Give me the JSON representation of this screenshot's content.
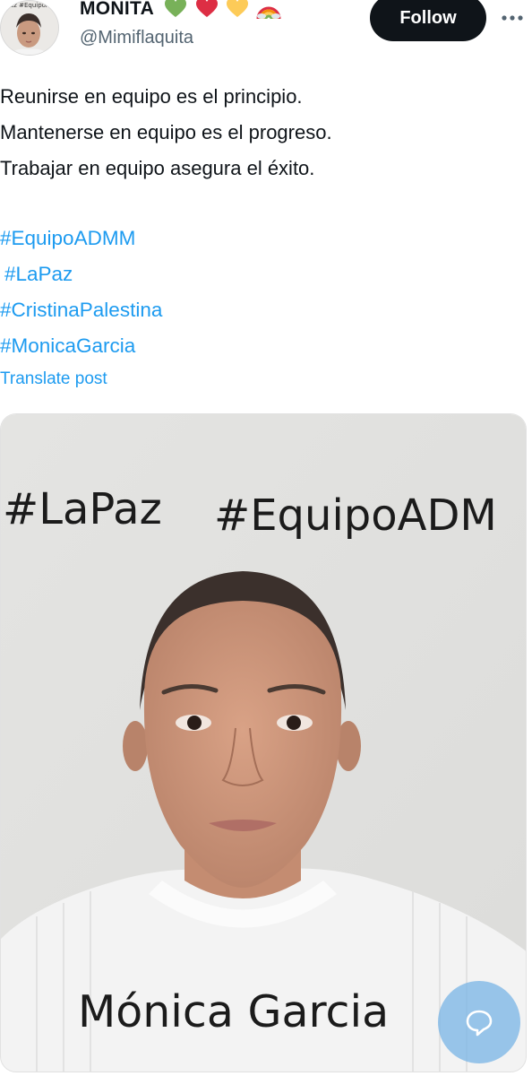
{
  "colors": {
    "text_primary": "#0f1419",
    "text_secondary": "#536471",
    "link": "#1d9bf0",
    "follow_bg": "#0f1419",
    "follow_text": "#ffffff",
    "fab_bg": "#8cc2ec"
  },
  "author": {
    "display_name": "MONITA",
    "name_emojis": [
      "green-heart-emoji",
      "red-heart-emoji",
      "yellow-heart-emoji",
      "rainbow-emoji"
    ],
    "handle": "@Mimiflaquita",
    "avatar_caption": "Paz  #EquipoA"
  },
  "actions": {
    "follow_label": "Follow",
    "more_icon": "more-horizontal-icon"
  },
  "post": {
    "lines": [
      "Reunirse en equipo es el principio.",
      "Mantenerse en equipo es el progreso.",
      "Trabajar en equipo asegura el éxito."
    ],
    "hashtags": [
      "#EquipoADMM",
      "#LaPaz",
      "#CristinaPalestina",
      "#MonicaGarcia"
    ],
    "translate_label": "Translate post"
  },
  "media": {
    "tag_1": "#LaPaz",
    "tag_2": "#EquipoADM",
    "name": "Mónica Garcia"
  },
  "fab": {
    "icon": "reply-bubble-icon"
  }
}
